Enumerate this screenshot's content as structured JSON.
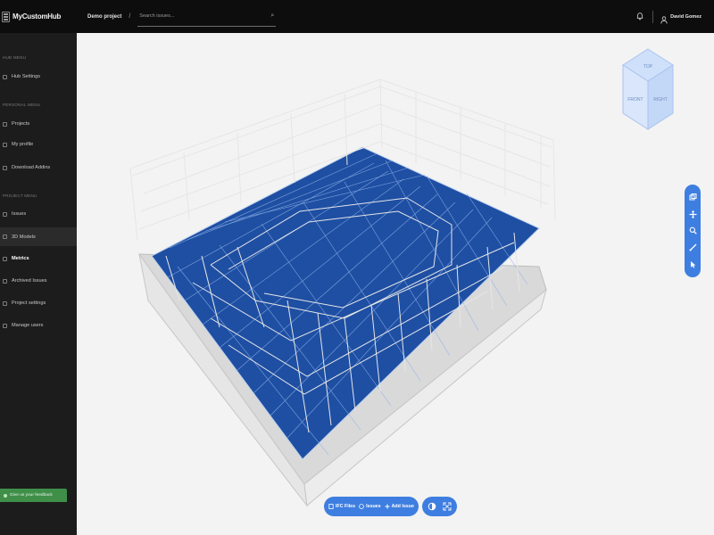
{
  "app": {
    "name": "MyCustomHub",
    "project": "Demo project",
    "breadcrumb_sep": "/",
    "search_placeholder": "Search issues...",
    "user_name": "David Gomez"
  },
  "sidebar": {
    "sections": [
      {
        "label": "HUB MENU"
      },
      {
        "label": "PERSONAL MENU"
      },
      {
        "label": "PROJECT MENU"
      }
    ],
    "items": [
      {
        "label": "Hub Settings",
        "icon": "gear-icon"
      },
      {
        "label": "Projects",
        "icon": "folder-icon"
      },
      {
        "label": "My profile",
        "icon": "user-icon"
      },
      {
        "label": "Download Addins",
        "icon": "download-icon"
      },
      {
        "label": "Issues",
        "icon": "issue-icon"
      },
      {
        "label": "3D Models",
        "icon": "cube-icon",
        "active": true
      },
      {
        "label": "Metrics",
        "icon": "chart-icon",
        "bold": true
      },
      {
        "label": "Archived Issues",
        "icon": "archive-icon"
      },
      {
        "label": "Project settings",
        "icon": "settings-icon"
      },
      {
        "label": "Manage users",
        "icon": "users-icon"
      }
    ],
    "feedback_label": "Give us your feedback"
  },
  "viewer": {
    "viewcube": {
      "top": "TOP",
      "front": "FRONT",
      "right": "RIGHT"
    },
    "tools": [
      "layers-icon",
      "move-icon",
      "zoom-icon",
      "measure-icon",
      "select-icon"
    ],
    "bottom_toolbar": {
      "ifc_files": "IFC Files",
      "issues": "Issues",
      "add_issue": "Add Issue"
    },
    "accent_color": "#3e7ee0",
    "floor_color": "#1e4fa3"
  }
}
